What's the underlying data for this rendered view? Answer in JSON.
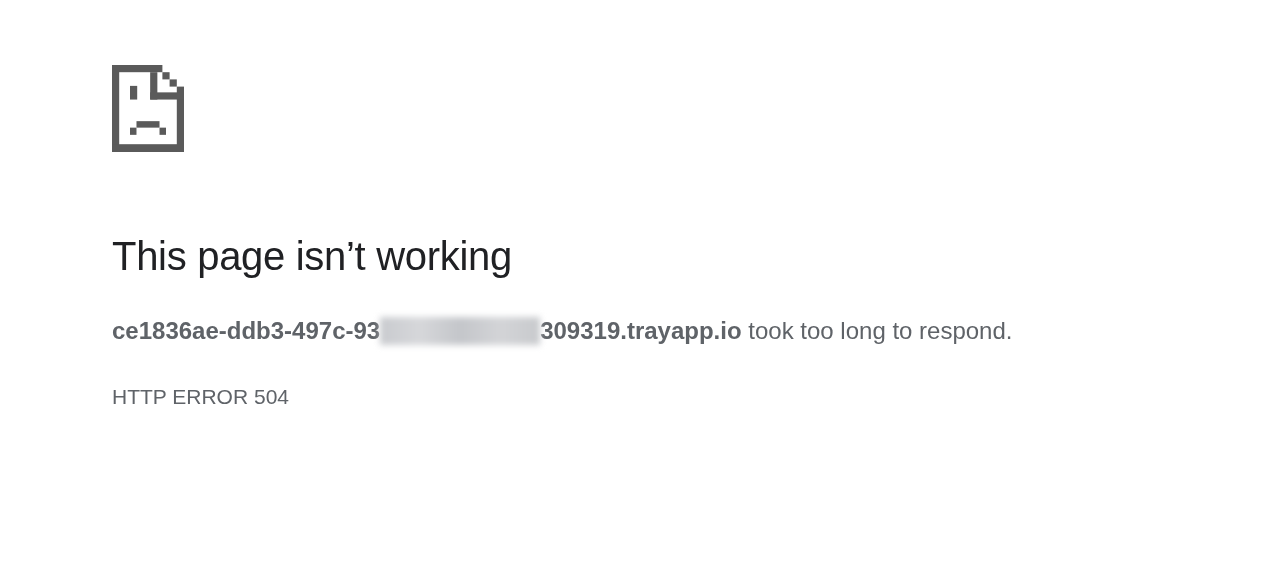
{
  "title": "This page isn’t working",
  "message": {
    "host_start": "ce1836ae-ddb3-497c-93",
    "host_end": "309319.trayapp.io",
    "rest": "took too long to respond."
  },
  "error_code": "HTTP ERROR 504"
}
